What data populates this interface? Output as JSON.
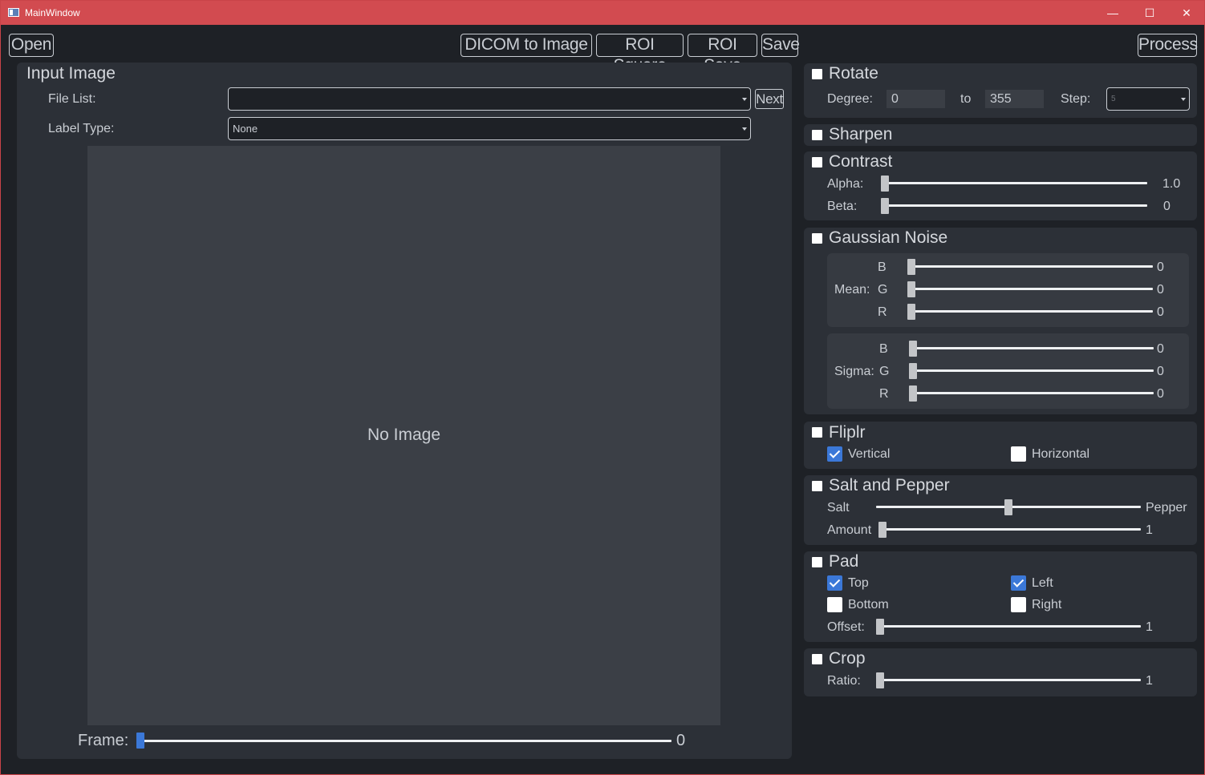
{
  "window": {
    "title": "MainWindow"
  },
  "titlebar": {
    "minimize": "—",
    "maximize": "☐",
    "close": "✕"
  },
  "toolbar": {
    "open": "Open",
    "dicom_to_image": "DICOM to Image",
    "roi_square": "ROI Square",
    "roi_save": "ROI Save",
    "save": "Save",
    "process": "Process"
  },
  "input": {
    "title": "Input Image",
    "file_list_label": "File List:",
    "file_list_value": "",
    "next": "Next",
    "label_type_label": "Label Type:",
    "label_type_value": "None",
    "placeholder": "No Image",
    "frame_label": "Frame:",
    "frame_value": "0"
  },
  "rotate": {
    "title": "Rotate",
    "degree_label": "Degree:",
    "degree_from": "0",
    "to_label": "to",
    "degree_to": "355",
    "step_label": "Step:",
    "step_value": "5"
  },
  "sharpen": {
    "title": "Sharpen"
  },
  "contrast": {
    "title": "Contrast",
    "alpha_label": "Alpha:",
    "alpha_value": "1.0",
    "beta_label": "Beta:",
    "beta_value": "0"
  },
  "gaussian": {
    "title": "Gaussian Noise",
    "mean_label": "Mean:",
    "sigma_label": "Sigma:",
    "mean": [
      {
        "ch": "B",
        "value": "0"
      },
      {
        "ch": "G",
        "value": "0"
      },
      {
        "ch": "R",
        "value": "0"
      }
    ],
    "sigma": [
      {
        "ch": "B",
        "value": "0"
      },
      {
        "ch": "G",
        "value": "0"
      },
      {
        "ch": "R",
        "value": "0"
      }
    ]
  },
  "fliplr": {
    "title": "Fliplr",
    "vertical": "Vertical",
    "vertical_checked": true,
    "horizontal": "Horizontal",
    "horizontal_checked": false
  },
  "salt_pepper": {
    "title": "Salt and Pepper",
    "salt_label": "Salt",
    "pepper_label": "Pepper",
    "ratio": 0.5,
    "amount_label": "Amount",
    "amount_value": "1"
  },
  "pad": {
    "title": "Pad",
    "top": "Top",
    "top_checked": true,
    "left": "Left",
    "left_checked": true,
    "bottom": "Bottom",
    "bottom_checked": false,
    "right": "Right",
    "right_checked": false,
    "offset_label": "Offset:",
    "offset_value": "1"
  },
  "crop": {
    "title": "Crop",
    "ratio_label": "Ratio:",
    "ratio_value": "1"
  },
  "colors": {
    "accent": "#3b78d8",
    "titlebar": "#d24b50",
    "background": "#1e2126",
    "panel": "#2c3037"
  }
}
